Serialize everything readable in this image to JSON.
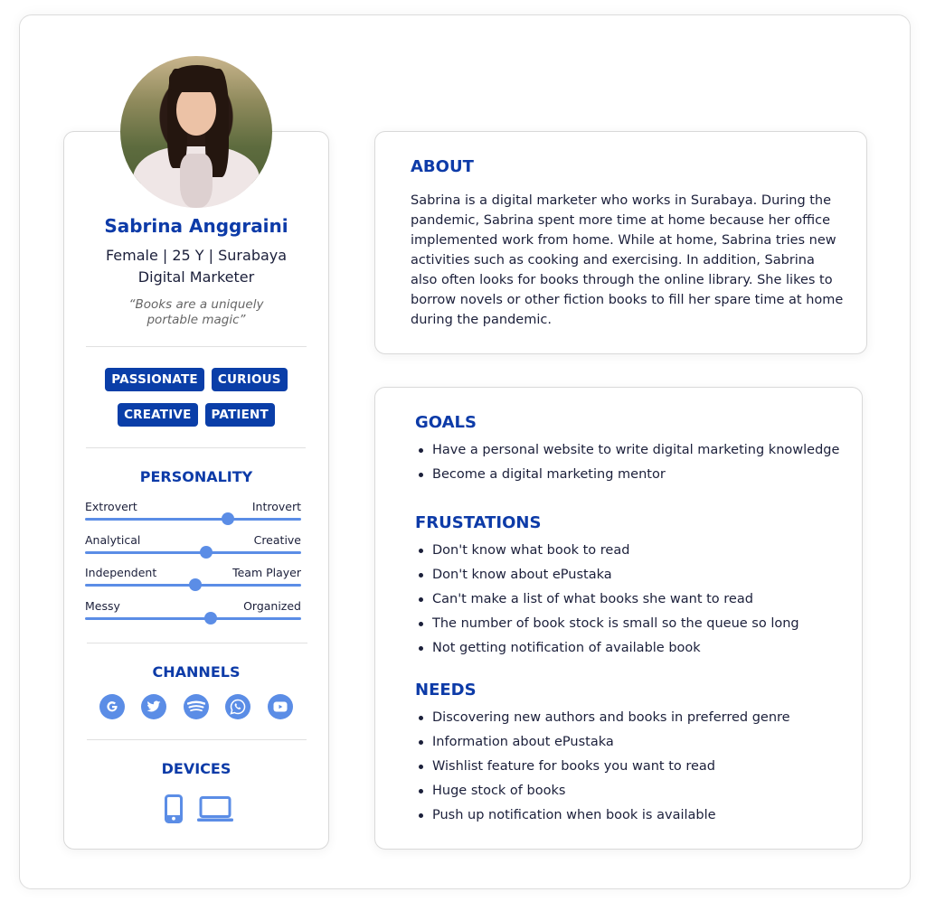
{
  "profile": {
    "name": "Sabrina Anggraini",
    "demographics": "Female | 25 Y | Surabaya",
    "occupation": "Digital Marketer",
    "quote_line1": "“Books are a uniquely",
    "quote_line2": "portable magic”",
    "avatar": "profile-photo"
  },
  "traits": [
    "PASSIONATE",
    "CURIOUS",
    "CREATIVE",
    "PATIENT"
  ],
  "personality": {
    "title": "PERSONALITY",
    "sliders": [
      {
        "left": "Extrovert",
        "right": "Introvert",
        "value": 0.66
      },
      {
        "left": "Analytical",
        "right": "Creative",
        "value": 0.56
      },
      {
        "left": "Independent",
        "right": "Team Player",
        "value": 0.51
      },
      {
        "left": "Messy",
        "right": "Organized",
        "value": 0.58
      }
    ]
  },
  "channels": {
    "title": "CHANNELS",
    "items": [
      "google-icon",
      "twitter-icon",
      "spotify-icon",
      "whatsapp-icon",
      "youtube-icon"
    ]
  },
  "devices": {
    "title": "DEVICES",
    "items": [
      "smartphone-icon",
      "laptop-icon"
    ]
  },
  "about": {
    "title": "ABOUT",
    "text": "Sabrina is a digital marketer who works in Surabaya. During the pandemic, Sabrina spent more time at home because her office implemented work from home. While at home, Sabrina tries new activities such as cooking and exercising. In addition, Sabrina also often looks for books through the online library. She likes to borrow novels or other fiction books to fill her spare time at home during the pandemic."
  },
  "goals": {
    "title": "GOALS",
    "items": [
      "Have a personal website to write digital marketing knowledge",
      "Become a digital marketing mentor"
    ]
  },
  "frustrations": {
    "title": "FRUSTATIONS",
    "items": [
      "Don't know what book to read",
      "Don't know about ePustaka",
      "Can't make a list of what books she want to read",
      "The number of book stock is small so the queue so long",
      "Not getting notification of available book"
    ]
  },
  "needs": {
    "title": "NEEDS",
    "items": [
      "Discovering new authors and books in preferred genre",
      "Information about ePustaka",
      "Wishlist feature for books you want to read",
      "Huge stock of books",
      "Push up notification when book is available"
    ]
  },
  "colors": {
    "primary": "#0d3ba8",
    "tag_bg": "#0a3ea8",
    "accent": "#5b8de6",
    "text": "#1b1f3a"
  }
}
